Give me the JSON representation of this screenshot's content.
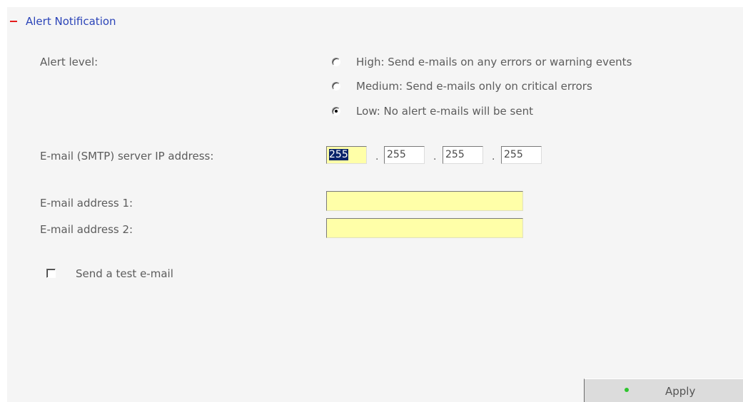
{
  "section": {
    "title": "Alert Notification",
    "collapse_symbol": "−"
  },
  "alert_level": {
    "label": "Alert level:",
    "options": [
      {
        "label": "High: Send e-mails on any errors or warning events",
        "checked": false
      },
      {
        "label": "Medium: Send e-mails only on critical errors",
        "checked": false
      },
      {
        "label": "Low: No alert e-mails will be sent",
        "checked": true
      }
    ]
  },
  "smtp": {
    "label": "E-mail (SMTP) server IP address:",
    "octets": [
      "255",
      "255",
      "255",
      "255"
    ],
    "separator": "."
  },
  "email1": {
    "label": "E-mail address 1:",
    "value": ""
  },
  "email2": {
    "label": "E-mail address 2:",
    "value": ""
  },
  "test_email": {
    "label": "Send a test e-mail",
    "checked": false
  },
  "apply_button": {
    "label": "Apply"
  },
  "colors": {
    "panel_bg": "#f5f5f5",
    "header_link": "#2b44b8",
    "collapse_icon": "#e41c1c",
    "input_highlight": "#ffffa8",
    "apply_indicator": "#2fc52f"
  }
}
